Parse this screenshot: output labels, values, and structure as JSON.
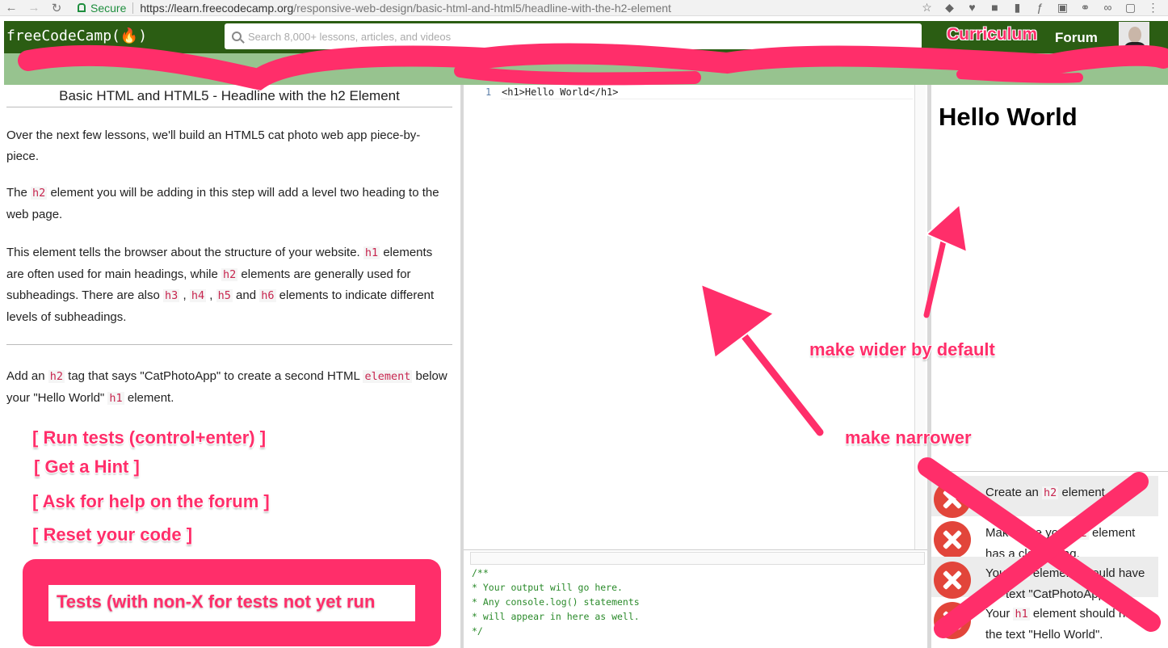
{
  "browser": {
    "secure_label": "Secure",
    "url_host": "https://learn.freecodecamp.org",
    "url_path": "/responsive-web-design/basic-html-and-html5/headline-with-the-h2-element"
  },
  "header": {
    "logo": "freeCodeCamp(🔥)",
    "search_placeholder": "Search 8,000+ lessons, articles, and videos",
    "curriculum": "Curriculum",
    "forum": "Forum"
  },
  "lesson": {
    "title": "Basic HTML and HTML5 - Headline with the h2 Element",
    "p1": "Over the next few lessons, we'll build an HTML5 cat photo web app piece-by-piece.",
    "p2_a": "The ",
    "p2_code": "h2",
    "p2_b": " element you will be adding in this step will add a level two heading to the web page.",
    "p3_a": "This element tells the browser about the structure of your website. ",
    "p3_c1": "h1",
    "p3_b": " elements are often used for main headings, while ",
    "p3_c2": "h2",
    "p3_c": " elements are generally used for subheadings. There are also ",
    "p3_c3": "h3",
    "p3_d": " , ",
    "p3_c4": "h4",
    "p3_e": " , ",
    "p3_c5": "h5",
    "p3_f": " and ",
    "p3_c6": "h6",
    "p3_g": " elements to indicate different levels of subheadings.",
    "p4_a": "Add an ",
    "p4_c1": "h2",
    "p4_b": " tag that says \"CatPhotoApp\" to create a second HTML ",
    "p4_c2": "element",
    "p4_c": " below your \"Hello World\" ",
    "p4_c3": "h1",
    "p4_d": " element."
  },
  "editor": {
    "line_number": "1",
    "code": "<h1>Hello World</h1>"
  },
  "console": {
    "text": "/**\n* Your output will go here.\n* Any console.log() statements\n* will appear in here as well.\n*/"
  },
  "preview": {
    "heading": "Hello World"
  },
  "tests": [
    {
      "a": "Create an ",
      "code": "h2",
      "b": " element."
    },
    {
      "a": "Make sure your ",
      "code": "h2",
      "b": " element has a closing tag."
    },
    {
      "a": "Your ",
      "code": "h2",
      "b": " element should have the text \"CatPhotoApp\"."
    },
    {
      "a": "Your ",
      "code": "h1",
      "b": " element should have the text \"Hello World\"."
    }
  ],
  "annotations": {
    "run_tests": "[ Run tests  (control+enter) ]",
    "get_hint": "[ Get a Hint ]",
    "ask_help": "[ Ask for help on the forum ]",
    "reset": "[ Reset your code ]",
    "tests_box": "Tests (with non-X for tests not yet run",
    "make_wider": "make wider by default",
    "make_narrower": "make narrower"
  },
  "colors": {
    "annotation": "#ff2e6a",
    "nav_bg": "#2b5d13",
    "subbar_bg": "#97c38f",
    "test_fail": "#e2453a"
  }
}
